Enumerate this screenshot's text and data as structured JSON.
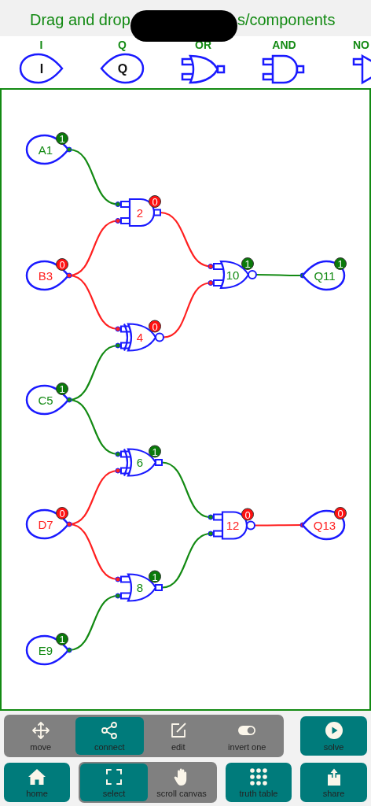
{
  "header": {
    "text_before": "Drag and drop",
    "text_after": "s/components"
  },
  "palette": [
    {
      "kind": "input",
      "label": "I",
      "symbol": "I"
    },
    {
      "kind": "output",
      "label": "Q",
      "symbol": "Q"
    },
    {
      "kind": "or",
      "label": "OR"
    },
    {
      "kind": "and",
      "label": "AND"
    },
    {
      "kind": "not",
      "label": "NO"
    }
  ],
  "circuit": {
    "inputs": [
      {
        "label": "A1",
        "badge": "1",
        "high": true
      },
      {
        "label": "B3",
        "badge": "0",
        "high": false
      },
      {
        "label": "C5",
        "badge": "1",
        "high": true
      },
      {
        "label": "D7",
        "badge": "0",
        "high": false
      },
      {
        "label": "E9",
        "badge": "1",
        "high": true
      }
    ],
    "gates": [
      {
        "kind": "and",
        "label": "2",
        "badge": "0",
        "high": false
      },
      {
        "kind": "xnor",
        "label": "4",
        "badge": "0",
        "high": false
      },
      {
        "kind": "xor",
        "label": "6",
        "badge": "1",
        "high": true
      },
      {
        "kind": "or",
        "label": "8",
        "badge": "1",
        "high": true
      },
      {
        "kind": "nor",
        "label": "10",
        "badge": "1",
        "high": true
      },
      {
        "kind": "nand",
        "label": "12",
        "badge": "0",
        "high": false
      }
    ],
    "outputs": [
      {
        "label": "Q11",
        "badge": "1",
        "high": true
      },
      {
        "label": "Q13",
        "badge": "0",
        "high": false
      }
    ]
  },
  "toolbar": {
    "mode_group": [
      {
        "kind": "move",
        "label": "move",
        "selected": false
      },
      {
        "kind": "connect",
        "label": "connect",
        "selected": true
      },
      {
        "kind": "edit",
        "label": "edit",
        "selected": false
      },
      {
        "kind": "toggle",
        "label": "invert one",
        "selected": false
      }
    ],
    "solve": {
      "label": "solve"
    },
    "home": {
      "label": "home"
    },
    "view_group": [
      {
        "kind": "select",
        "label": "select",
        "selected": true
      },
      {
        "kind": "hand",
        "label": "scroll canvas",
        "selected": false
      }
    ],
    "truth_table": {
      "label": "truth table"
    },
    "share": {
      "label": "share"
    }
  }
}
